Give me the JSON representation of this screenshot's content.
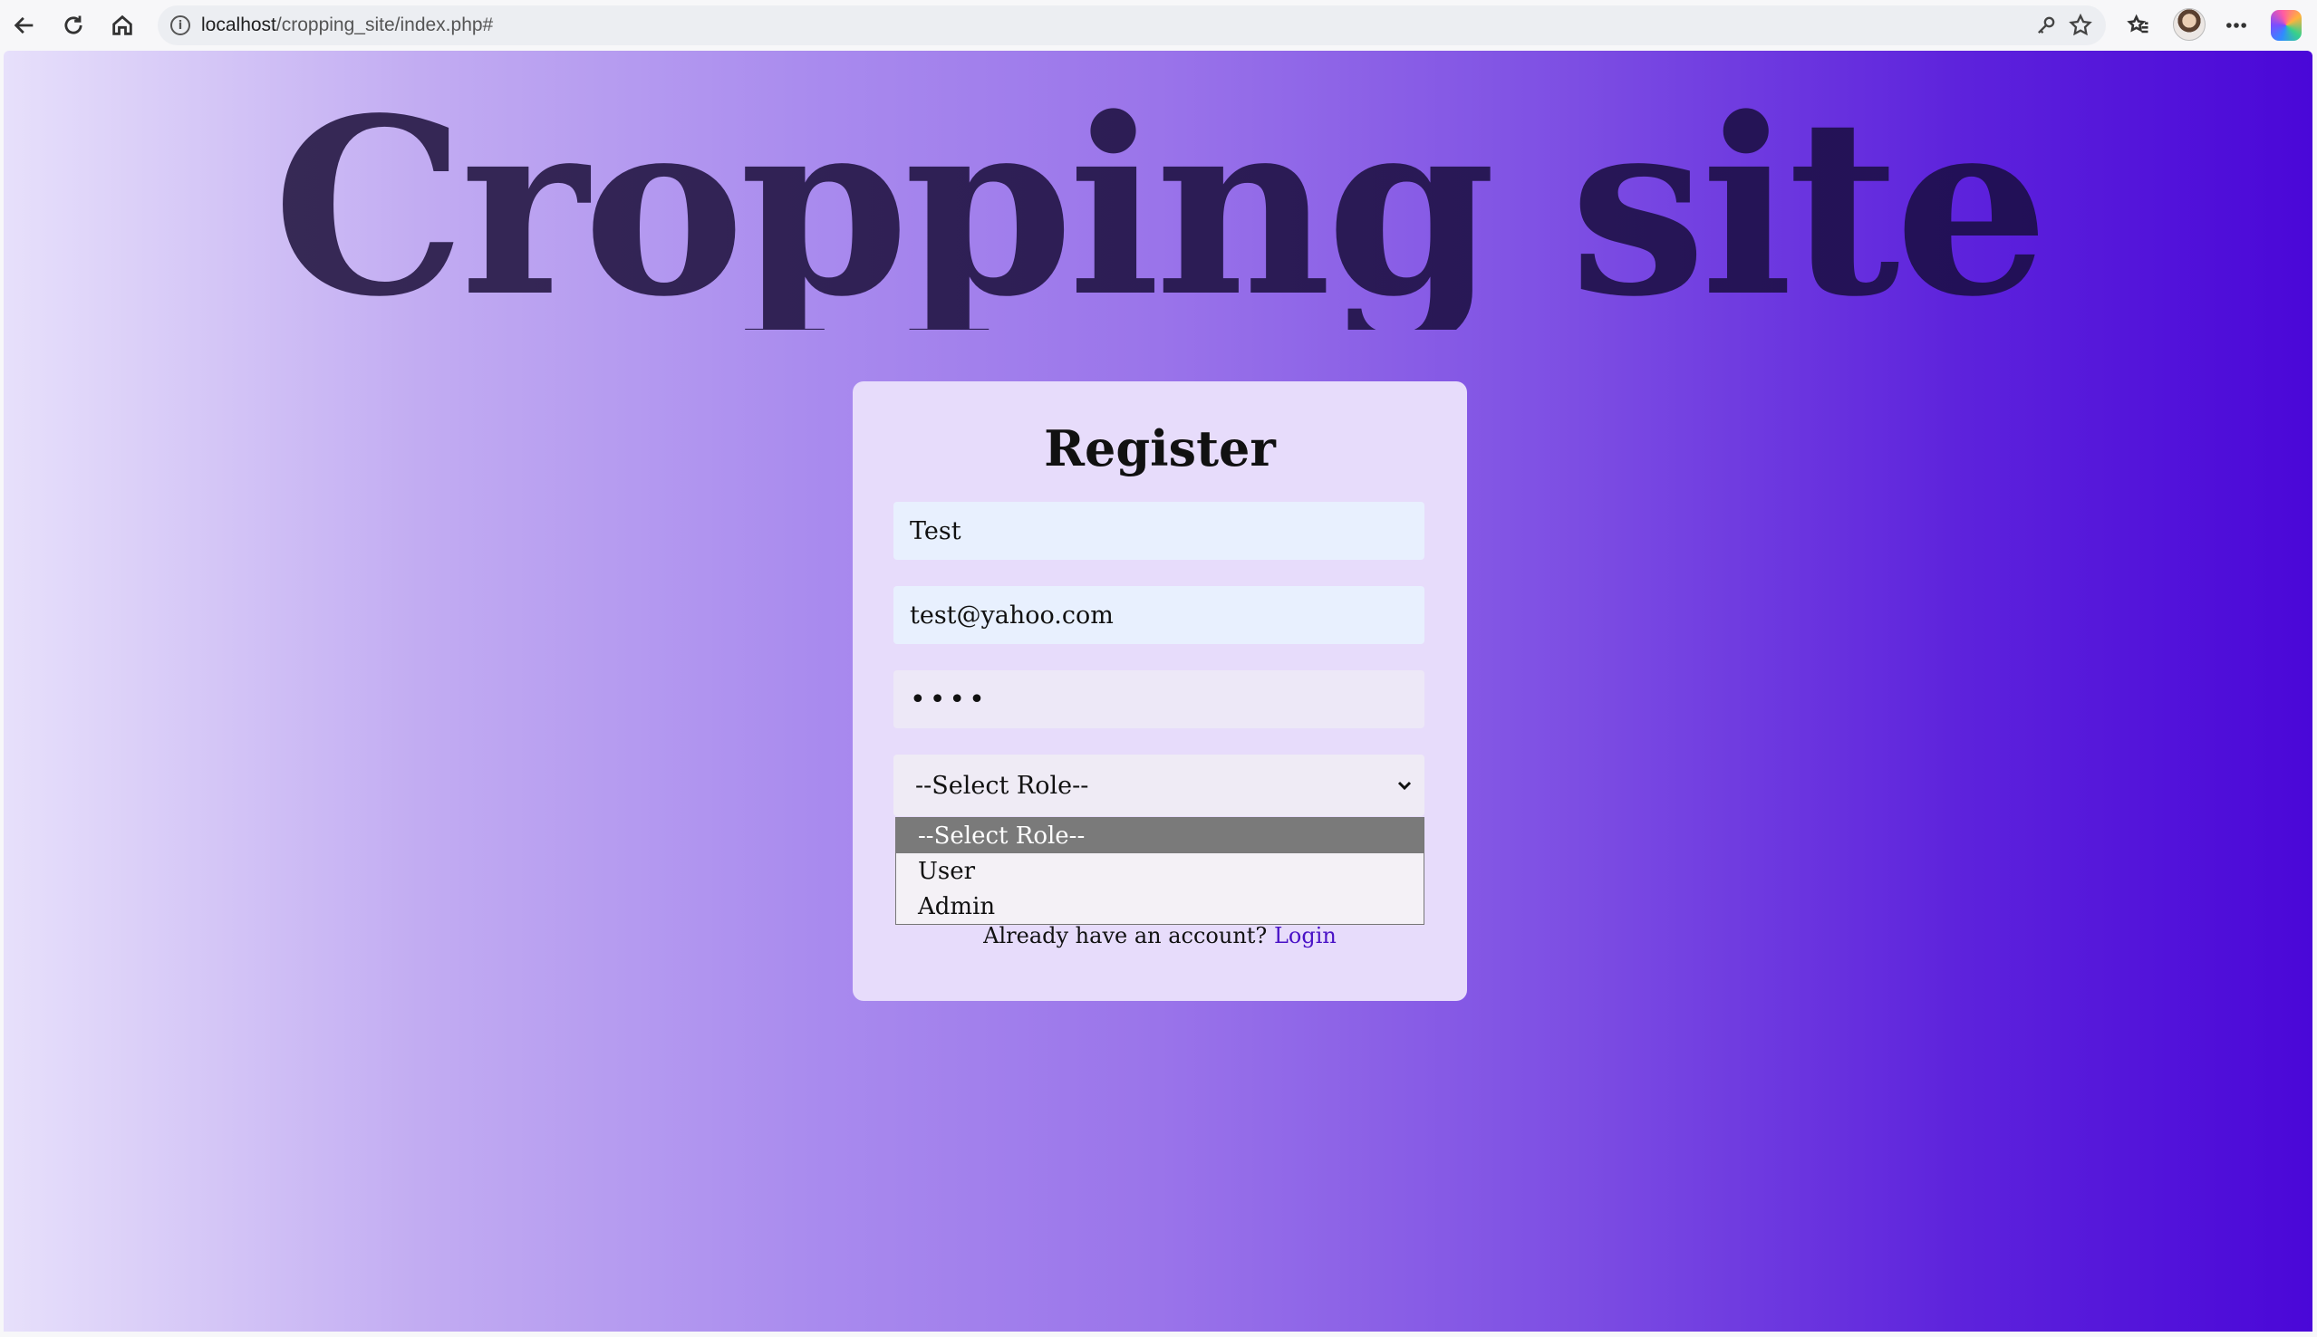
{
  "browser": {
    "url_host": "localhost",
    "url_path": "/cropping_site/index.php#",
    "icons": [
      "back-icon",
      "reload-icon",
      "home-icon",
      "site-info-icon",
      "key-icon",
      "star-icon",
      "favorites-icon",
      "profile-avatar",
      "more-icon",
      "copilot-icon"
    ]
  },
  "page": {
    "site_title": "Cropping site"
  },
  "register": {
    "title": "Register",
    "username_value": "Test",
    "email_value": "test@yahoo.com",
    "password_value": "••••",
    "role_selected": "--Select Role--",
    "role_options": [
      "--Select Role--",
      "User",
      "Admin"
    ],
    "already_text": "Already have an account?",
    "login_link": "Login"
  },
  "colors": {
    "gradient_start": "#e7e0fb",
    "gradient_end": "#4a07d8",
    "card_bg": "#e7dcfb",
    "link": "#4a12c6"
  }
}
